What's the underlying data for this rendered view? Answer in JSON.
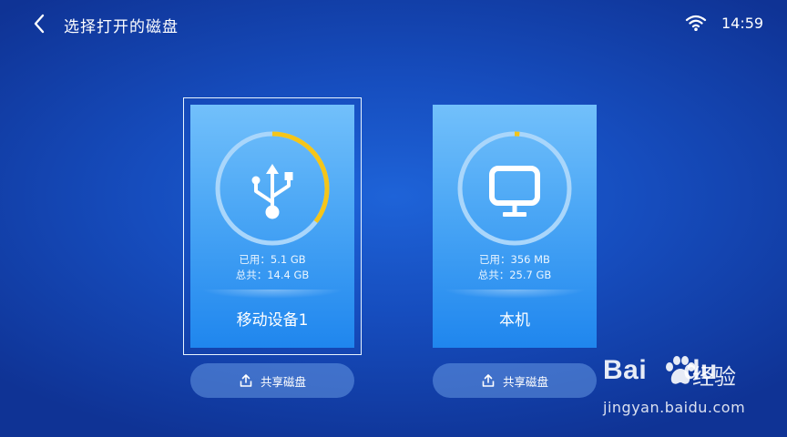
{
  "header": {
    "title": "选择打开的磁盘",
    "time": "14:59",
    "back_icon": "chevron-left-icon",
    "wifi_icon": "wifi-icon"
  },
  "disks": [
    {
      "name": "移动设备1",
      "icon": "usb-icon",
      "used_label": "已用：5.1 GB",
      "total_label": "总共：14.4 GB",
      "usage_fraction": 0.354,
      "selected": true,
      "share_label": "共享磁盘"
    },
    {
      "name": "本机",
      "icon": "monitor-icon",
      "used_label": "已用：356 MB",
      "total_label": "总共：25.7 GB",
      "usage_fraction": 0.014,
      "selected": false,
      "share_label": "共享磁盘"
    }
  ],
  "colors": {
    "usage_arc": "#f5c518",
    "ring_track": "#a9d6fb",
    "card_top": "#72c0fb",
    "card_bottom": "#1f86ee"
  },
  "watermark": {
    "brand_left": "Bai",
    "brand_right": "du",
    "suffix": "经验",
    "url": "jingyan.baidu.com"
  }
}
